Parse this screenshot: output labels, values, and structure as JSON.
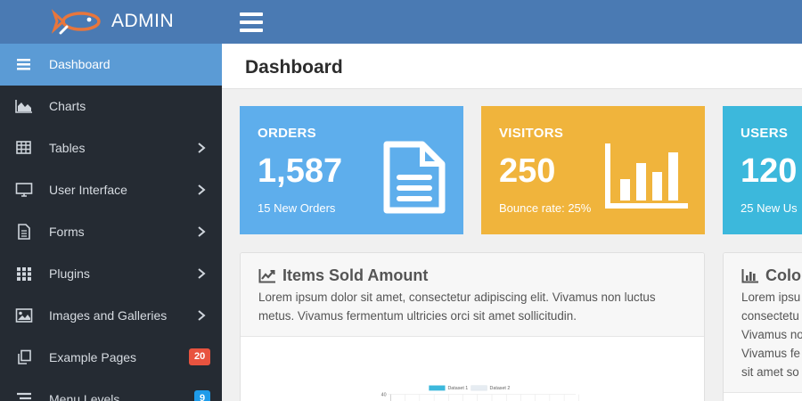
{
  "app": {
    "brand": "ADMIN"
  },
  "sidebar": {
    "items": [
      {
        "label": "Dashboard",
        "icon": "menu-icon",
        "active": true
      },
      {
        "label": "Charts",
        "icon": "area-chart-icon"
      },
      {
        "label": "Tables",
        "icon": "table-icon",
        "chevron": true
      },
      {
        "label": "User Interface",
        "icon": "monitor-icon",
        "chevron": true
      },
      {
        "label": "Forms",
        "icon": "document-icon",
        "chevron": true
      },
      {
        "label": "Plugins",
        "icon": "grid-icon",
        "chevron": true
      },
      {
        "label": "Images and Galleries",
        "icon": "image-icon",
        "chevron": true
      },
      {
        "label": "Example Pages",
        "icon": "copy-icon",
        "badge": "20",
        "badge_color": "#e8533f"
      },
      {
        "label": "Menu Levels",
        "icon": "list-icon",
        "badge": "9",
        "badge_color": "#1e9be9"
      }
    ]
  },
  "header": {
    "title": "Dashboard"
  },
  "stats": [
    {
      "title": "ORDERS",
      "value": "1,587",
      "sub": "15 New Orders",
      "color": "#5eaeec",
      "icon": "file-text-icon"
    },
    {
      "title": "VISITORS",
      "value": "250",
      "sub": "Bounce rate: 25%",
      "color": "#f0b43c",
      "icon": "bar-chart-icon"
    },
    {
      "title": "USERS",
      "value": "120",
      "sub": "25 New Us",
      "color": "#3cb8dc",
      "icon": "users-icon"
    }
  ],
  "panels": {
    "items_sold": {
      "title": "Items Sold Amount",
      "desc": "Lorem ipsum dolor sit amet, consectetur adipiscing elit. Vivamus non luctus metus. Vivamus fermentum ultricies orci sit amet sollicitudin."
    },
    "colors": {
      "title": "Colo",
      "lines": [
        "Lorem ipsu",
        "consectetu",
        "Vivamus no",
        "Vivamus fe",
        "sit amet so"
      ]
    }
  },
  "chart_data": {
    "type": "bar",
    "series": [
      {
        "name": "Dataset 1",
        "color": "#3cb8dc"
      },
      {
        "name": "Dataset 2",
        "color": "#e6ecf2"
      }
    ],
    "y_ticks": [
      "40"
    ],
    "grid": true,
    "legend": "top-center"
  }
}
